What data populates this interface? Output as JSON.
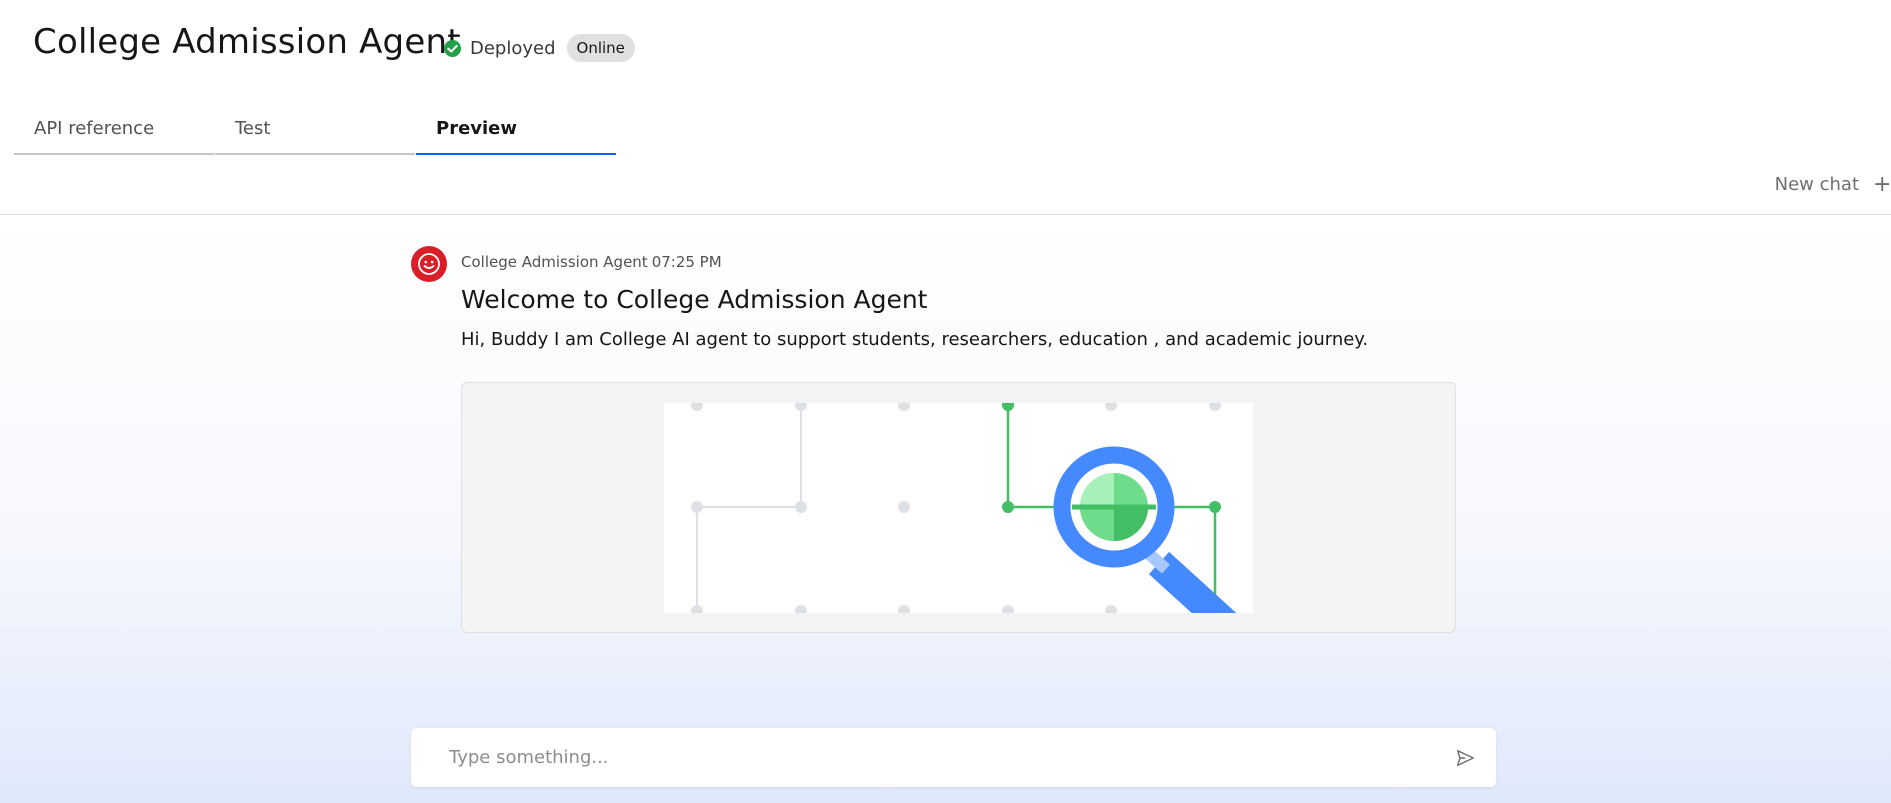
{
  "header": {
    "title": "College Admission Agent",
    "status": "Deployed",
    "badge": "Online"
  },
  "tabs": [
    {
      "label": "API reference",
      "active": false
    },
    {
      "label": "Test",
      "active": false
    },
    {
      "label": "Preview",
      "active": true
    }
  ],
  "toolbar": {
    "new_chat_label": "New chat",
    "new_chat_icon": "+"
  },
  "message": {
    "sender": "College Admission Agent",
    "time": "07:25 PM",
    "heading": "Welcome to College Admission Agent",
    "body": "Hi, Buddy I am College AI agent to support students, researchers, education , and academic journey.",
    "image_icon": "magnifier-network-illustration"
  },
  "composer": {
    "placeholder": "Type something..."
  },
  "colors": {
    "accent": "#0f62fe",
    "deployed_green": "#24a148",
    "avatar_red": "#da1e28",
    "illustration_green": "#42be65",
    "illustration_blue": "#4589ff"
  }
}
